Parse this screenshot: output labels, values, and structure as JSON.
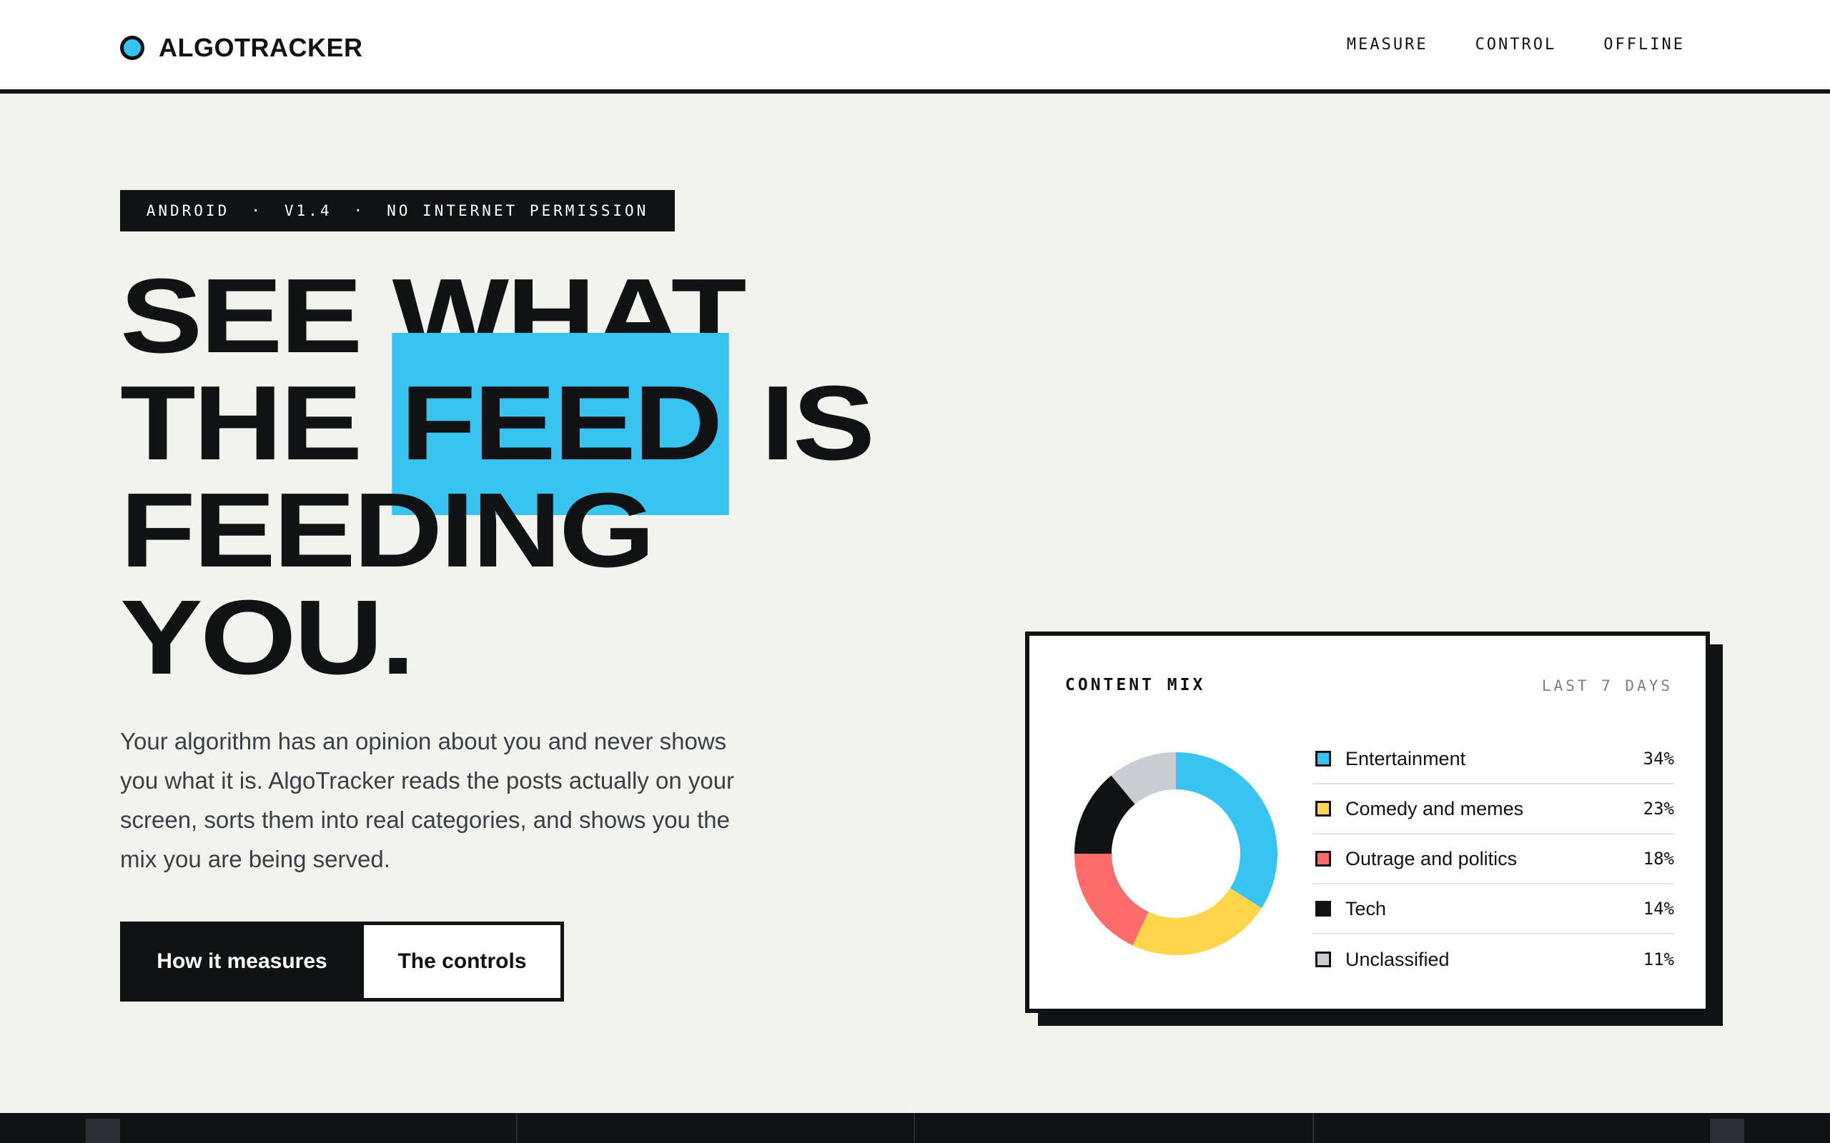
{
  "header": {
    "brand": "ALGOTRACKER",
    "nav": [
      "MEASURE",
      "CONTROL",
      "OFFLINE"
    ]
  },
  "hero": {
    "badge": {
      "platform": "ANDROID",
      "version": "V1.4",
      "permission": "NO INTERNET PERMISSION",
      "separator": "·"
    },
    "headline": {
      "line1": "SEE WHAT",
      "line2_pre": "THE ",
      "line2_highlight": "FEED",
      "line2_post": " IS",
      "line3": "FEEDING",
      "line4": "YOU."
    },
    "lede": "Your algorithm has an opinion about you and never shows you what it is. AlgoTracker reads the posts actually on your screen, sorts them into real categories, and shows you the mix you are being served.",
    "cta_primary": "How it measures",
    "cta_secondary": "The controls"
  },
  "colors": {
    "accent": "#38c4f0",
    "ink": "#111214",
    "background": "#f2f2ee"
  },
  "card": {
    "title": "CONTENT MIX",
    "range": "LAST 7 DAYS"
  },
  "chart_data": {
    "type": "pie",
    "donut": true,
    "categories": [
      "Entertainment",
      "Comedy and memes",
      "Outrage and politics",
      "Tech",
      "Unclassified"
    ],
    "values": [
      34,
      23,
      18,
      14,
      11
    ],
    "labels": [
      "34%",
      "23%",
      "18%",
      "14%",
      "11%"
    ],
    "colors": [
      "#38c4f0",
      "#fed54b",
      "#fd6b6b",
      "#111214",
      "#cacdd1"
    ],
    "legend": "right"
  }
}
